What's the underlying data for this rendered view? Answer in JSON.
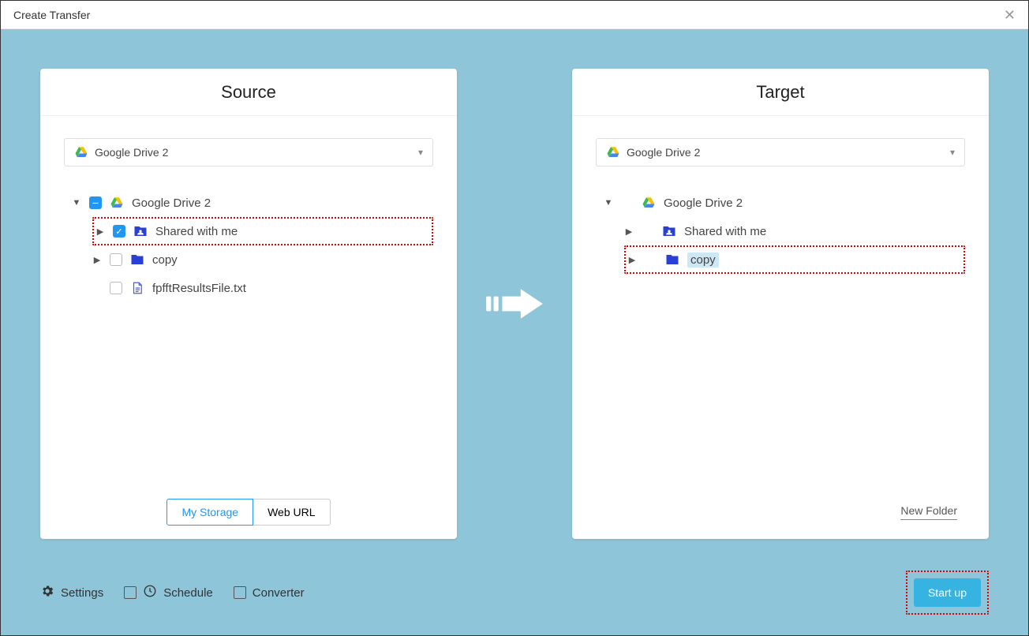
{
  "title": "Create Transfer",
  "source": {
    "title": "Source",
    "driveSelected": "Google Drive 2",
    "root": "Google Drive 2",
    "items": [
      {
        "label": "Shared with me"
      },
      {
        "label": "copy"
      },
      {
        "label": "fpfftResultsFile.txt"
      }
    ],
    "myStorageTab": "My Storage",
    "webUrlTab": "Web URL"
  },
  "target": {
    "title": "Target",
    "driveSelected": "Google Drive 2",
    "root": "Google Drive 2",
    "items": [
      {
        "label": "Shared with me"
      },
      {
        "label": "copy"
      }
    ],
    "newFolder": "New Folder"
  },
  "bottom": {
    "settings": "Settings",
    "schedule": "Schedule",
    "converter": "Converter",
    "startup": "Start up"
  }
}
